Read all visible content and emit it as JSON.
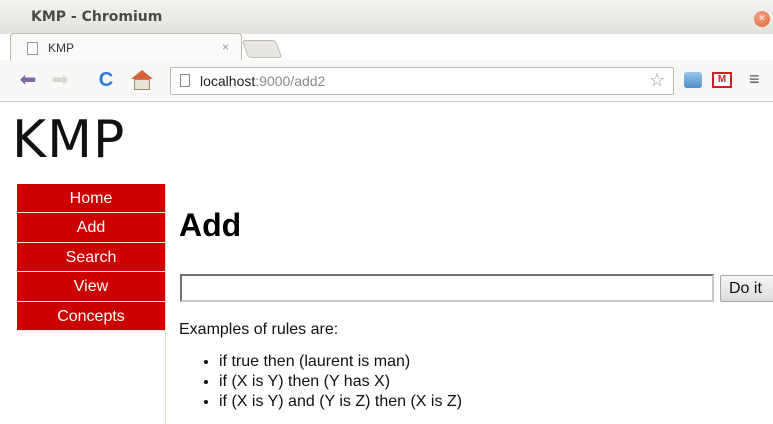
{
  "window": {
    "title": "KMP - Chromium",
    "close_glyph": "×"
  },
  "tab": {
    "label": "KMP",
    "close_glyph": "×"
  },
  "toolbar": {
    "back_glyph": "⬅",
    "forward_glyph": "➡",
    "reload_glyph": "C",
    "url_host": "localhost",
    "url_rest": ":9000/add2",
    "star_glyph": "☆",
    "gmail_glyph": "M",
    "menu_glyph": "≡"
  },
  "icons": {
    "back": "back-arrow-icon",
    "forward": "forward-arrow-icon",
    "reload": "reload-icon",
    "home": "home-icon",
    "star": "star-icon",
    "extension": "extension-icon",
    "gmail": "gmail-icon",
    "menu": "menu-icon"
  },
  "colors": {
    "nav_bg": "#cc0000",
    "nav_text": "#ffffff",
    "back_arrow": "#7d6aa8",
    "reload": "#2f7ad6"
  },
  "page": {
    "logo": "KMP",
    "nav": [
      "Home",
      "Add",
      "Search",
      "View",
      "Concepts"
    ],
    "heading": "Add",
    "input_value": "",
    "submit_label": "Do it",
    "examples_intro": "Examples of rules are:",
    "examples": [
      "if true then (laurent is man)",
      "if (X is Y) then (Y has X)",
      "if (X is Y) and (Y is Z) then (X is Z)"
    ]
  }
}
